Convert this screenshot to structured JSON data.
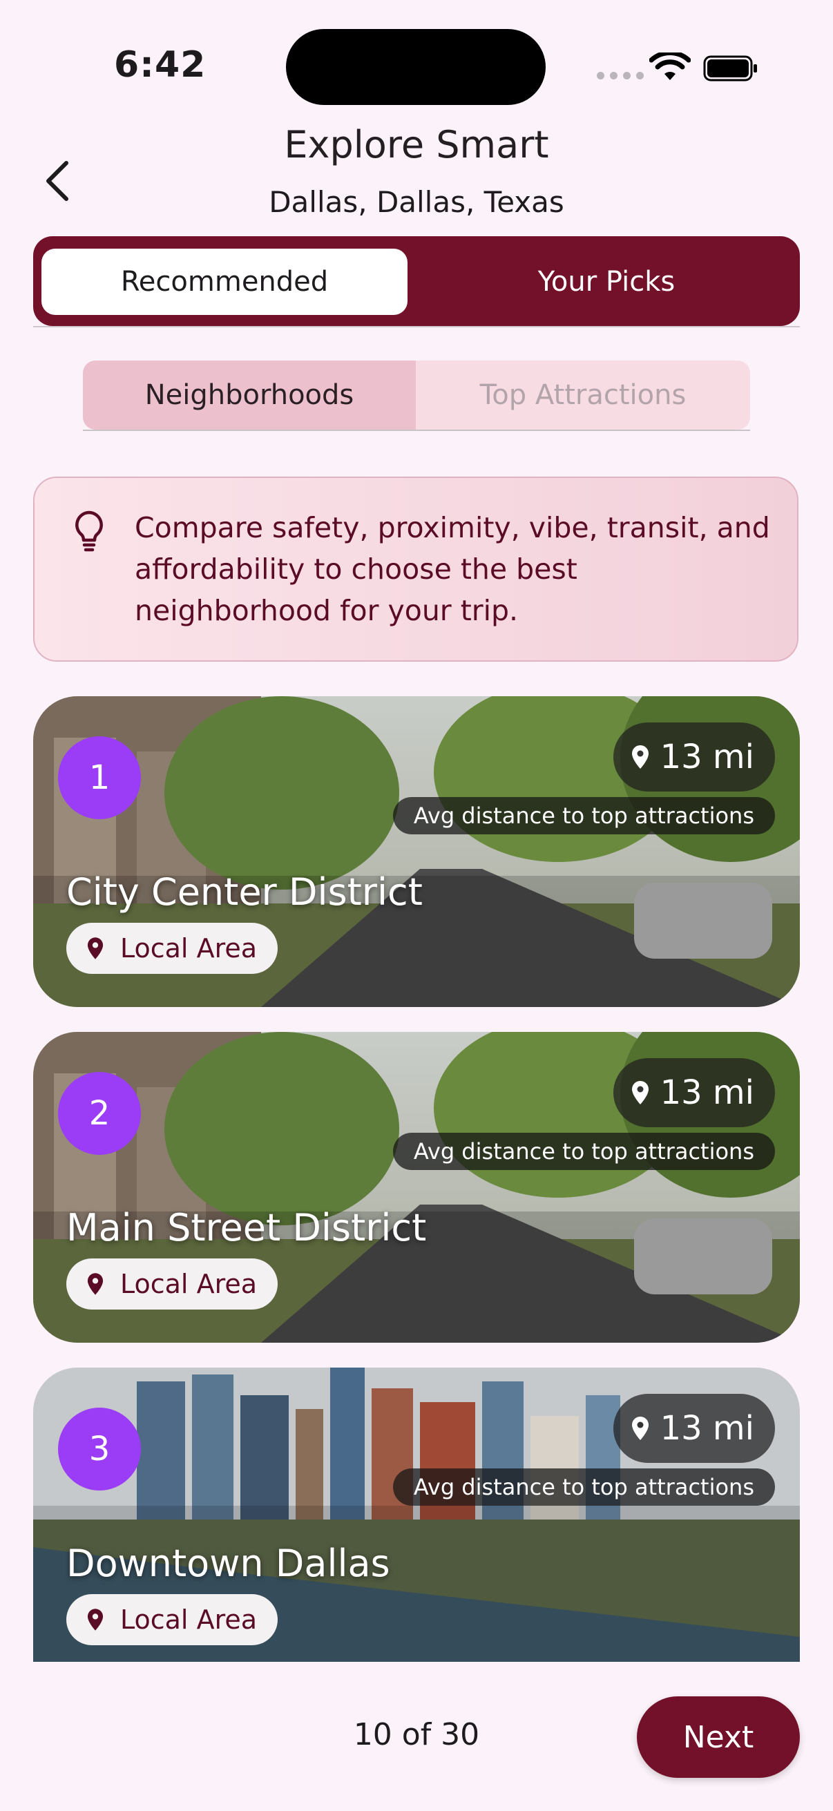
{
  "status_bar": {
    "time": "6:42"
  },
  "header": {
    "title": "Explore Smart",
    "subtitle": "Dallas, Dallas, Texas"
  },
  "tabs": {
    "active": "Recommended",
    "other": "Your Picks"
  },
  "subtabs": {
    "active": "Neighborhoods",
    "other": "Top Attractions"
  },
  "info": {
    "text": "Compare safety, proximity, vibe, transit, and affordability to choose the best neighborhood for your trip."
  },
  "cards": [
    {
      "number": "1",
      "name": "City Center District",
      "distance": "13 mi",
      "avg_label": "Avg distance to top attractions",
      "area_label": "Local Area",
      "scene": "suburban-street-photo"
    },
    {
      "number": "2",
      "name": "Main Street District",
      "distance": "13 mi",
      "avg_label": "Avg distance to top attractions",
      "area_label": "Local Area",
      "scene": "suburban-street-photo"
    },
    {
      "number": "3",
      "name": "Downtown Dallas",
      "distance": "13 mi",
      "avg_label": "Avg distance to top attractions",
      "area_label": "Local Area",
      "scene": "city-skyline-photo"
    }
  ],
  "footer": {
    "count": "10 of 30",
    "next_label": "Next"
  },
  "colors": {
    "brand": "#74112a",
    "badge": "#9b3cf6",
    "background": "#fcf2f9"
  },
  "icons": [
    "back-chevron-icon",
    "lightbulb-icon",
    "location-pin-icon",
    "wifi-icon",
    "battery-icon"
  ]
}
